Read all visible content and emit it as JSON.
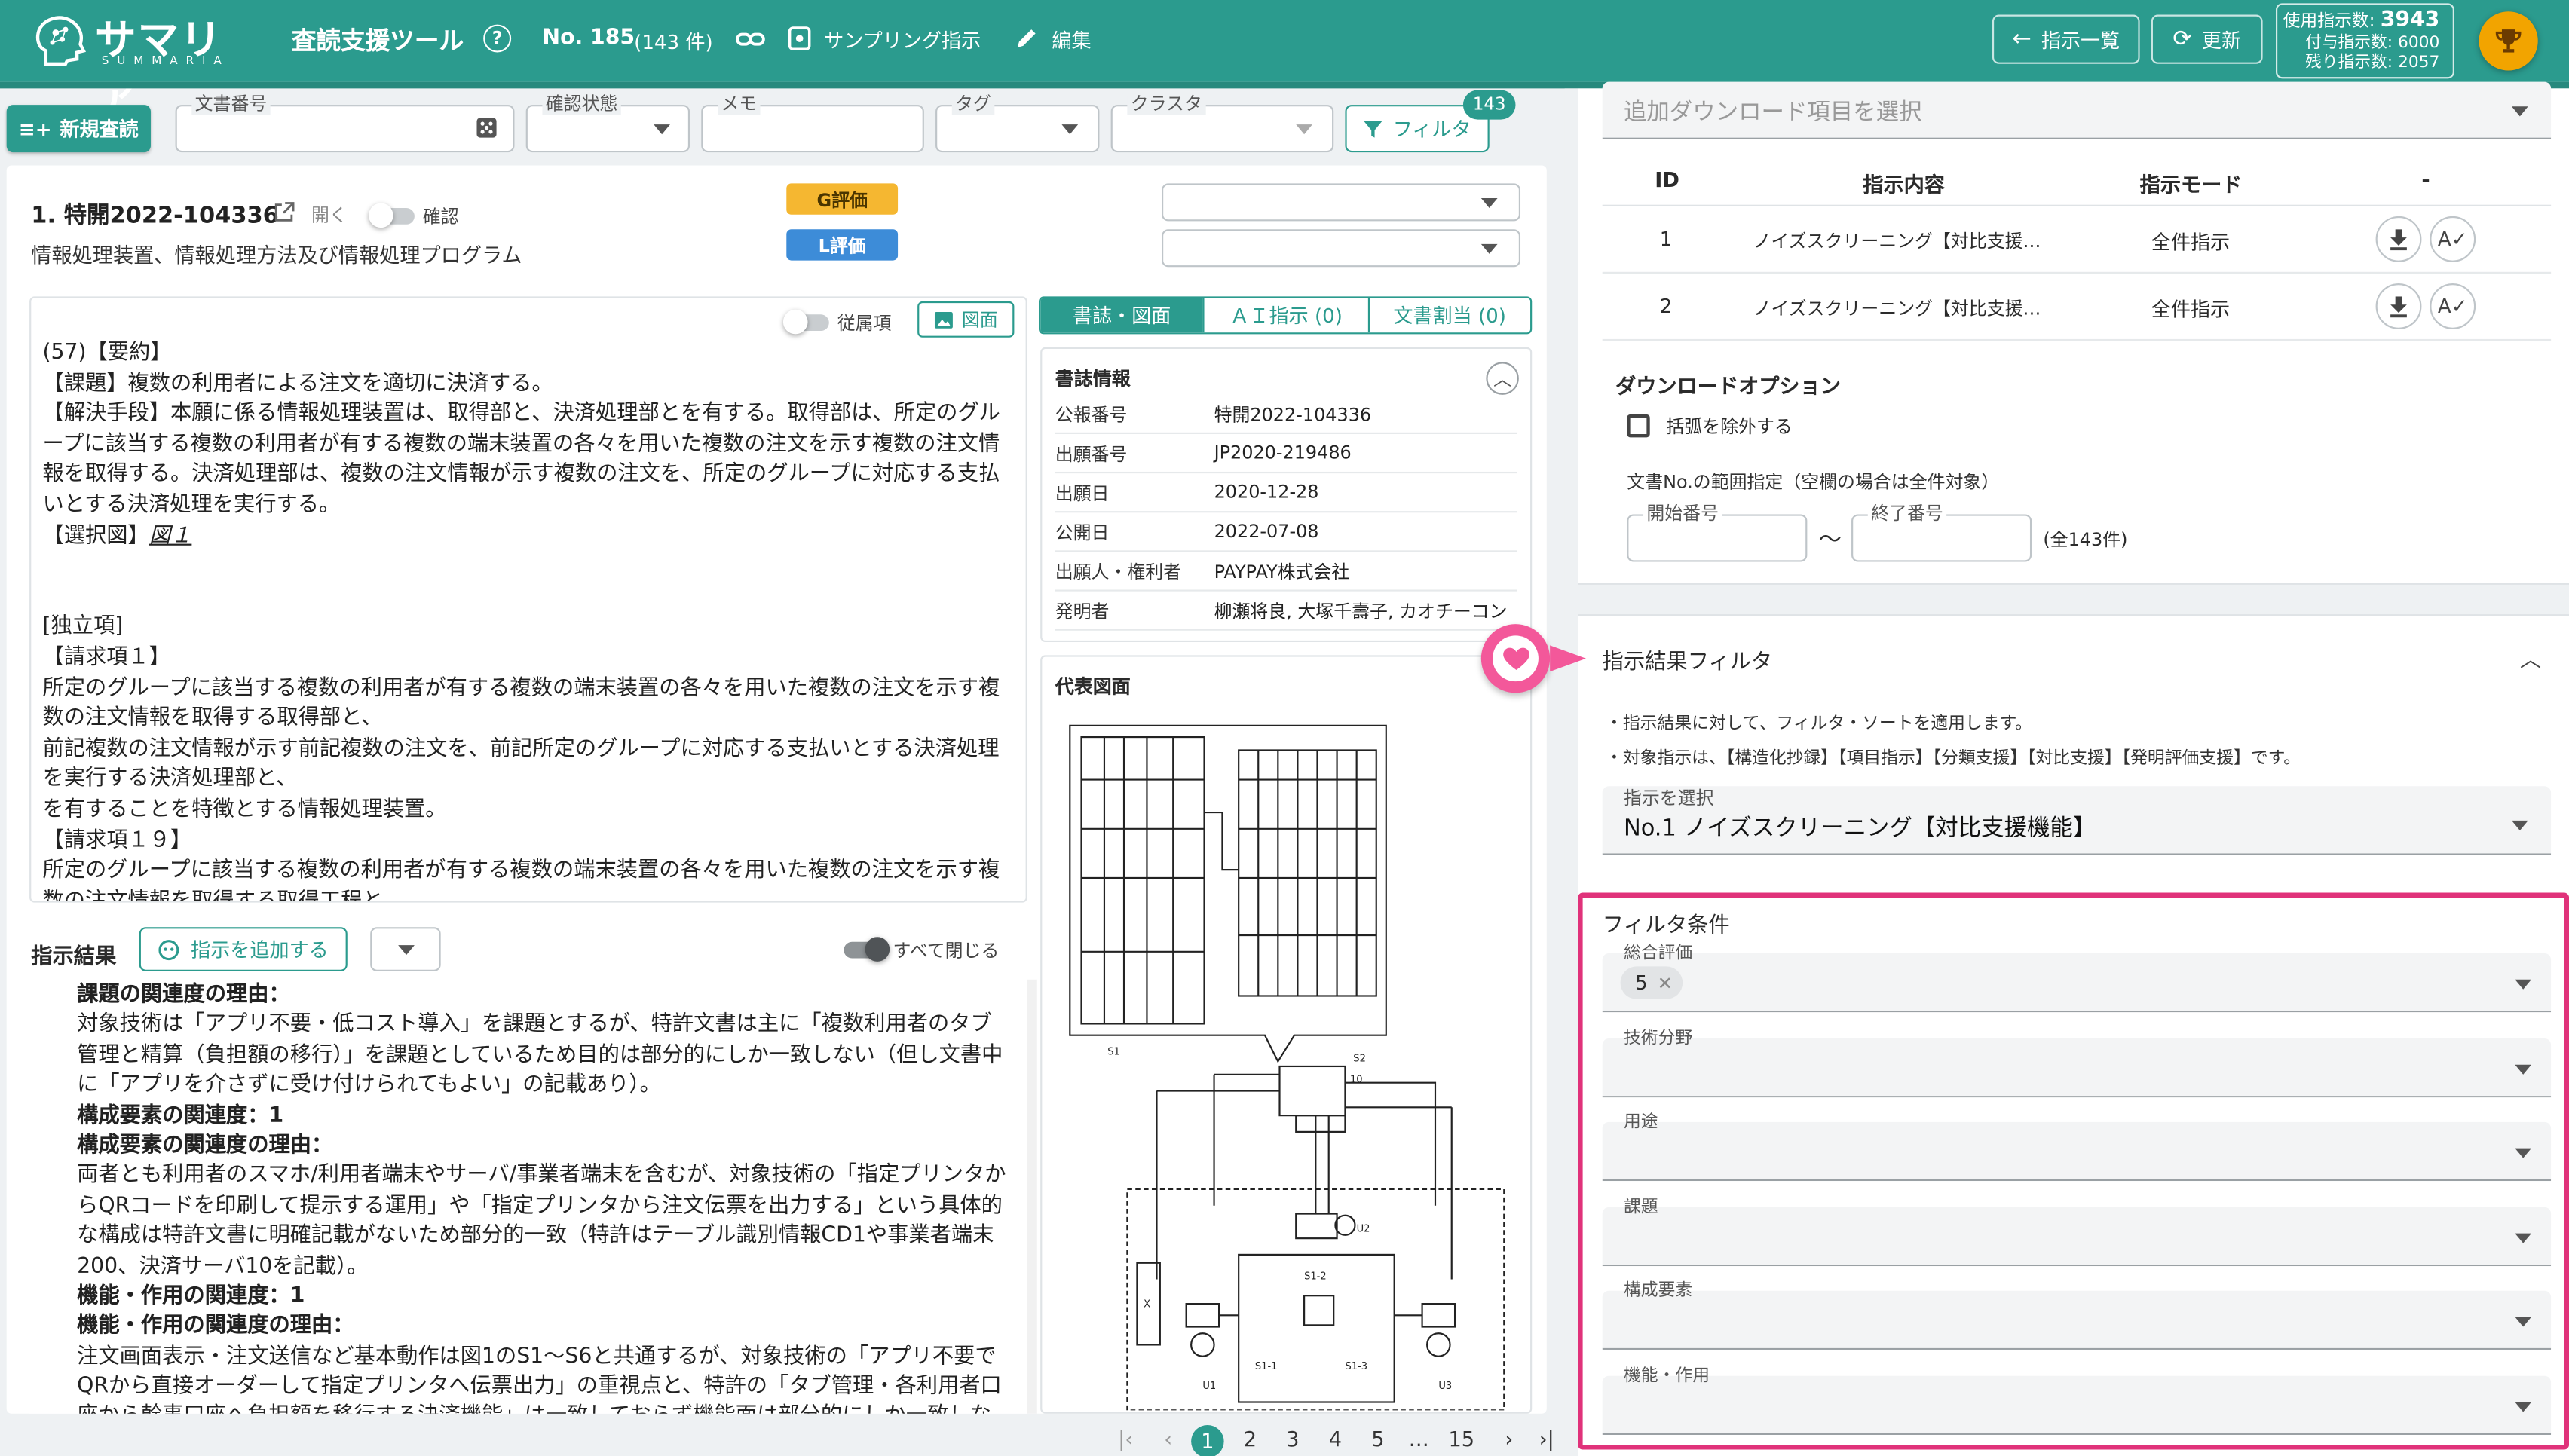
{
  "header": {
    "logo_text": "サマリア",
    "logo_sub": "SUMMARIA",
    "tool_title": "査読支援ツール",
    "doc_no_label": "No. 185",
    "doc_count": "(143 件)",
    "sampling_label": "サンプリング指示",
    "edit_label": "編集",
    "instruction_list_btn": "指示一覧",
    "refresh_btn": "更新",
    "usage": {
      "used_label": "使用指示数:",
      "used_value": "3943",
      "granted_label": "付与指示数:",
      "granted_value": "6000",
      "remaining_label": "残り指示数:",
      "remaining_value": "2057"
    },
    "colors": {
      "bar": "#2b9b8e",
      "trophy": "#f2a400"
    }
  },
  "toolbar": {
    "new_review_btn": "新規査読",
    "doc_number_label": "文書番号",
    "confirm_state_label": "確認状態",
    "memo_label": "メモ",
    "tag_label": "タグ",
    "cluster_label": "クラスタ",
    "filter_btn": "フィルタ",
    "filter_badge": "143"
  },
  "document": {
    "title": "1. 特開2022-104336",
    "open_label": "開く",
    "confirm_label": "確認",
    "subtitle": "情報処理装置、情報処理方法及び情報処理プログラム",
    "g_eval": "G評価",
    "l_eval": "L評価",
    "subordinate_label": "従属項",
    "figure_btn": "図面",
    "abstract_lines": [
      "(57)【要約】",
      "【課題】複数の利用者による注文を適切に決済する。",
      "【解決手段】本願に係る情報処理装置は、取得部と、決済処理部とを有する。取得部は、所定のグル",
      "ープに該当する複数の利用者が有する複数の端末装置の各々を用いた複数の注文を示す複数の注文情",
      "報を取得する。決済処理部は、複数の注文情報が示す複数の注文を、所定のグループに対応する支払",
      "いとする決済処理を実行する。",
      "【選択図】図１",
      "",
      "",
      "[独立項]",
      "【請求項１】",
      "所定のグループに該当する複数の利用者が有する複数の端末装置の各々を用いた複数の注文を示す複",
      "数の注文情報を取得する取得部と、",
      "前記複数の注文情報が示す前記複数の注文を、前記所定のグループに対応する支払いとする決済処理",
      "を実行する決済処理部と、",
      "を有することを特徴とする情報処理装置。",
      "【請求項１９】",
      "所定のグループに該当する複数の利用者が有する複数の端末装置の各々を用いた複数の注文を示す複",
      "数の注文情報を取得する取得工程と、"
    ]
  },
  "tabs": [
    {
      "label": "書誌・図面",
      "active": true
    },
    {
      "label": "ＡＩ指示 (0)",
      "active": false
    },
    {
      "label": "文書割当 (0)",
      "active": false
    }
  ],
  "biblio": {
    "title": "書誌情報",
    "rows": [
      {
        "k": "公報番号",
        "v": "特開2022-104336"
      },
      {
        "k": "出願番号",
        "v": "JP2020-219486"
      },
      {
        "k": "出願日",
        "v": "2020-12-28"
      },
      {
        "k": "公開日",
        "v": "2022-07-08"
      },
      {
        "k": "出願人・権利者",
        "v": "PAYPAY株式会社"
      },
      {
        "k": "発明者",
        "v": "柳瀬将良, 大塚千壽子, カオチーコン"
      }
    ],
    "figure_title": "代表図面"
  },
  "results": {
    "title": "指示結果",
    "add_btn": "指示を追加する",
    "close_all": "すべて閉じる",
    "lines": [
      {
        "t": "課題の関連度の理由：",
        "b": true
      },
      {
        "t": "対象技術は「アプリ不要・低コスト導入」を課題とするが、特許文書は主に「複数利用者のタブ",
        "b": false
      },
      {
        "t": "管理と精算（負担額の移行）」を課題としているため目的は部分的にしか一致しない（但し文書中",
        "b": false
      },
      {
        "t": "に「アプリを介さずに受け付けられてもよい」の記載あり）。",
        "b": false
      },
      {
        "t": "構成要素の関連度：1",
        "b": true
      },
      {
        "t": "構成要素の関連度の理由：",
        "b": true
      },
      {
        "t": "両者とも利用者のスマホ/利用者端末やサーバ/事業者端末を含むが、対象技術の「指定プリンタか",
        "b": false
      },
      {
        "t": "らQRコードを印刷して提示する運用」や「指定プリンタから注文伝票を出力する」という具体的",
        "b": false
      },
      {
        "t": "な構成は特許文書に明確記載がないため部分的一致（特許はテーブル識別情報CD1や事業者端末",
        "b": false
      },
      {
        "t": "200、決済サーバ10を記載）。",
        "b": false
      },
      {
        "t": "機能・作用の関連度：1",
        "b": true
      },
      {
        "t": "機能・作用の関連度の理由：",
        "b": true
      },
      {
        "t": "注文画面表示・注文送信など基本動作は図1のS1〜S6と共通するが、対象技術の「アプリ不要で",
        "b": false
      },
      {
        "t": "QRから直接オーダーして指定プリンタへ伝票出力」の重視点と、特許の「タブ管理・各利用者口",
        "b": false
      },
      {
        "t": "座から幹事口座へ負担額を移行する決済機能」は一致しておらず機能面は部分的にしか一致しな",
        "b": false
      }
    ]
  },
  "pagination": {
    "pages": [
      "1",
      "2",
      "3",
      "4",
      "5",
      "…",
      "15"
    ],
    "current": "1"
  },
  "right": {
    "download_select_placeholder": "追加ダウンロード項目を選択",
    "table_headers": [
      "ID",
      "指示内容",
      "指示モード",
      "-"
    ],
    "table_rows": [
      {
        "id": "1",
        "content": "ノイズスクリーニング【対比支援…",
        "mode": "全件指示"
      },
      {
        "id": "2",
        "content": "ノイズスクリーニング【対比支援…",
        "mode": "全件指示"
      }
    ],
    "download_options_title": "ダウンロードオプション",
    "exclude_brackets": "括弧を除外する",
    "range_label": "文書No.の範囲指定（空欄の場合は全件対象）",
    "start_label": "開始番号",
    "end_label": "終了番号",
    "total": "(全143件)",
    "result_filter_title": "指示結果フィルタ",
    "note1": "・指示結果に対して、フィルタ・ソートを適用します。",
    "note2": "・対象指示は、【構造化抄録】【項目指示】【分類支援】【対比支援】【発明評価支援】です。",
    "select_instruction_label": "指示を選択",
    "select_instruction_value": "No.1 ノイズスクリーニング【対比支援機能】",
    "filter_cond_title": "フィルタ条件",
    "filters": [
      {
        "label": "総合評価",
        "chip": "5"
      },
      {
        "label": "技術分野",
        "chip": ""
      },
      {
        "label": "用途",
        "chip": ""
      },
      {
        "label": "課題",
        "chip": ""
      },
      {
        "label": "構成要素",
        "chip": ""
      },
      {
        "label": "機能・作用",
        "chip": ""
      }
    ],
    "highlight_color": "#e0327a"
  }
}
